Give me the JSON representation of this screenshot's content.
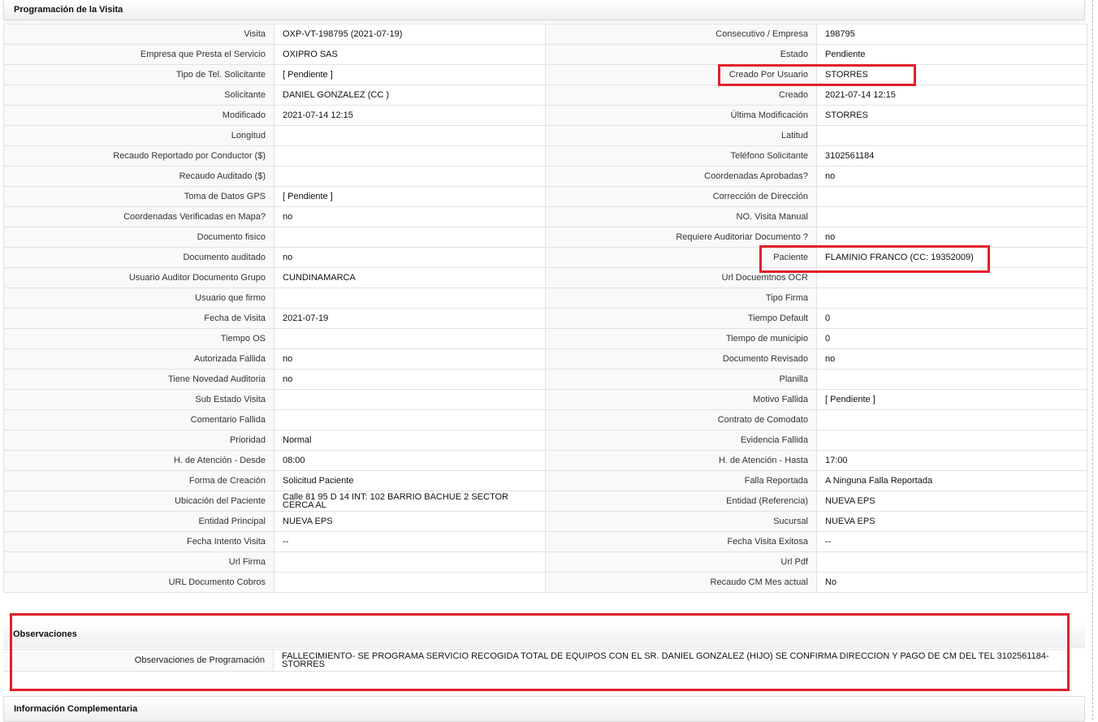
{
  "sections": {
    "programacion": "Programación de la Visita",
    "observaciones": "Observaciones",
    "complementaria": "Información Complementaria"
  },
  "rows": [
    {
      "l1": "Visita",
      "v1": "OXP-VT-198795 (2021-07-19)",
      "l2": "Consecutivo / Empresa",
      "v2": "198795"
    },
    {
      "l1": "Empresa que Presta el Servicio",
      "v1": "OXIPRO SAS",
      "l2": "Estado",
      "v2": "Pendiente"
    },
    {
      "l1": "Tipo de Tel. Solicitante",
      "v1": "[ Pendiente ]",
      "l2": "Creado Por Usuario",
      "v2": "STORRES"
    },
    {
      "l1": "Solicitante",
      "v1": "DANIEL GONZALEZ (CC )",
      "l2": "Creado",
      "v2": "2021-07-14 12:15"
    },
    {
      "l1": "Modificado",
      "v1": "2021-07-14 12:15",
      "l2": "Última Modificación",
      "v2": " STORRES"
    },
    {
      "l1": "Longitud",
      "v1": "",
      "l2": "Latitud",
      "v2": ""
    },
    {
      "l1": "Recaudo Reportado por Conductor ($)",
      "v1": "",
      "l2": "Teléfono Solicitante",
      "v2": "3102561184"
    },
    {
      "l1": "Recaudo Auditado ($)",
      "v1": "",
      "l2": "Coordenadas Aprobadas?",
      "v2": " no"
    },
    {
      "l1": "Toma de Datos GPS",
      "v1": "[ Pendiente ]",
      "l2": "Corrección de Dirección",
      "v2": ""
    },
    {
      "l1": "Coordenadas Verificadas en Mapa?",
      "v1": " no",
      "l2": "NO. Visita Manual",
      "v2": ""
    },
    {
      "l1": "Documento fisico",
      "v1": "",
      "l2": "Requiere Auditoriar Documento ?",
      "v2": " no"
    },
    {
      "l1": "Documento auditado",
      "v1": " no",
      "l2": "Paciente",
      "v2": "FLAMINIO FRANCO (CC: 19352009)"
    },
    {
      "l1": "Usuario Auditor Documento Grupo",
      "v1": "CUNDINAMARCA",
      "l2": "Url Docuemtnos OCR",
      "v2": ""
    },
    {
      "l1": "Usuario que firmo",
      "v1": "",
      "l2": "Tipo Firma",
      "v2": ""
    },
    {
      "l1": "Fecha de Visita",
      "v1": " 2021-07-19",
      "l2": "Tiempo Default",
      "v2": " 0"
    },
    {
      "l1": "Tiempo OS",
      "v1": "",
      "l2": "Tiempo de municipio",
      "v2": " 0"
    },
    {
      "l1": "Autorizada Fallida",
      "v1": " no",
      "l2": "Documento Revisado",
      "v2": " no"
    },
    {
      "l1": "Tiene Novedad Auditoria",
      "v1": " no",
      "l2": "Planilla",
      "v2": ""
    },
    {
      "l1": "Sub Estado Visita",
      "v1": "",
      "l2": "Motivo Fallida",
      "v2": "[ Pendiente ]"
    },
    {
      "l1": "Comentario Fallida",
      "v1": "",
      "l2": "Contrato de Comodato",
      "v2": ""
    },
    {
      "l1": "Prioridad",
      "v1": "Normal",
      "l2": "Evidencia Fallida",
      "v2": ""
    },
    {
      "l1": "H. de Atención - Desde",
      "v1": "08:00",
      "l2": "H. de Atención - Hasta",
      "v2": "17:00"
    },
    {
      "l1": "Forma de Creación",
      "v1": "Solicitud Paciente",
      "l2": "Falla Reportada",
      "v2": "A Ninguna Falla Reportada"
    },
    {
      "l1": "Ubicación del Paciente",
      "v1": "Calle 81 95 D 14 INT: 102 BARRIO BACHUE 2 SECTOR CERCA AL",
      "l2": "Entidad (Referencia)",
      "v2": "NUEVA EPS"
    },
    {
      "l1": "Entidad Principal",
      "v1": "NUEVA EPS",
      "l2": "Sucursal",
      "v2": "NUEVA EPS"
    },
    {
      "l1": "Fecha Intento Visita",
      "v1": " --",
      "l2": "Fecha Visita Exitosa",
      "v2": " --"
    },
    {
      "l1": "Url Firma",
      "v1": "",
      "l2": "Url Pdf",
      "v2": ""
    },
    {
      "l1": "URL Documento Cobros",
      "v1": "",
      "l2": "Recaudo CM Mes actual",
      "v2": " No"
    }
  ],
  "observaciones": {
    "label": "Observaciones de Programación",
    "value": " FALLECIMIENTO- SE PROGRAMA SERVICIO RECOGIDA TOTAL DE EQUIPOS CON EL SR. DANIEL GONZALEZ (HIJO) SE CONFIRMA DIRECCION Y PAGO DE CM DEL TEL 3102561184- STORRES"
  },
  "highlight_color": "#e0202a"
}
